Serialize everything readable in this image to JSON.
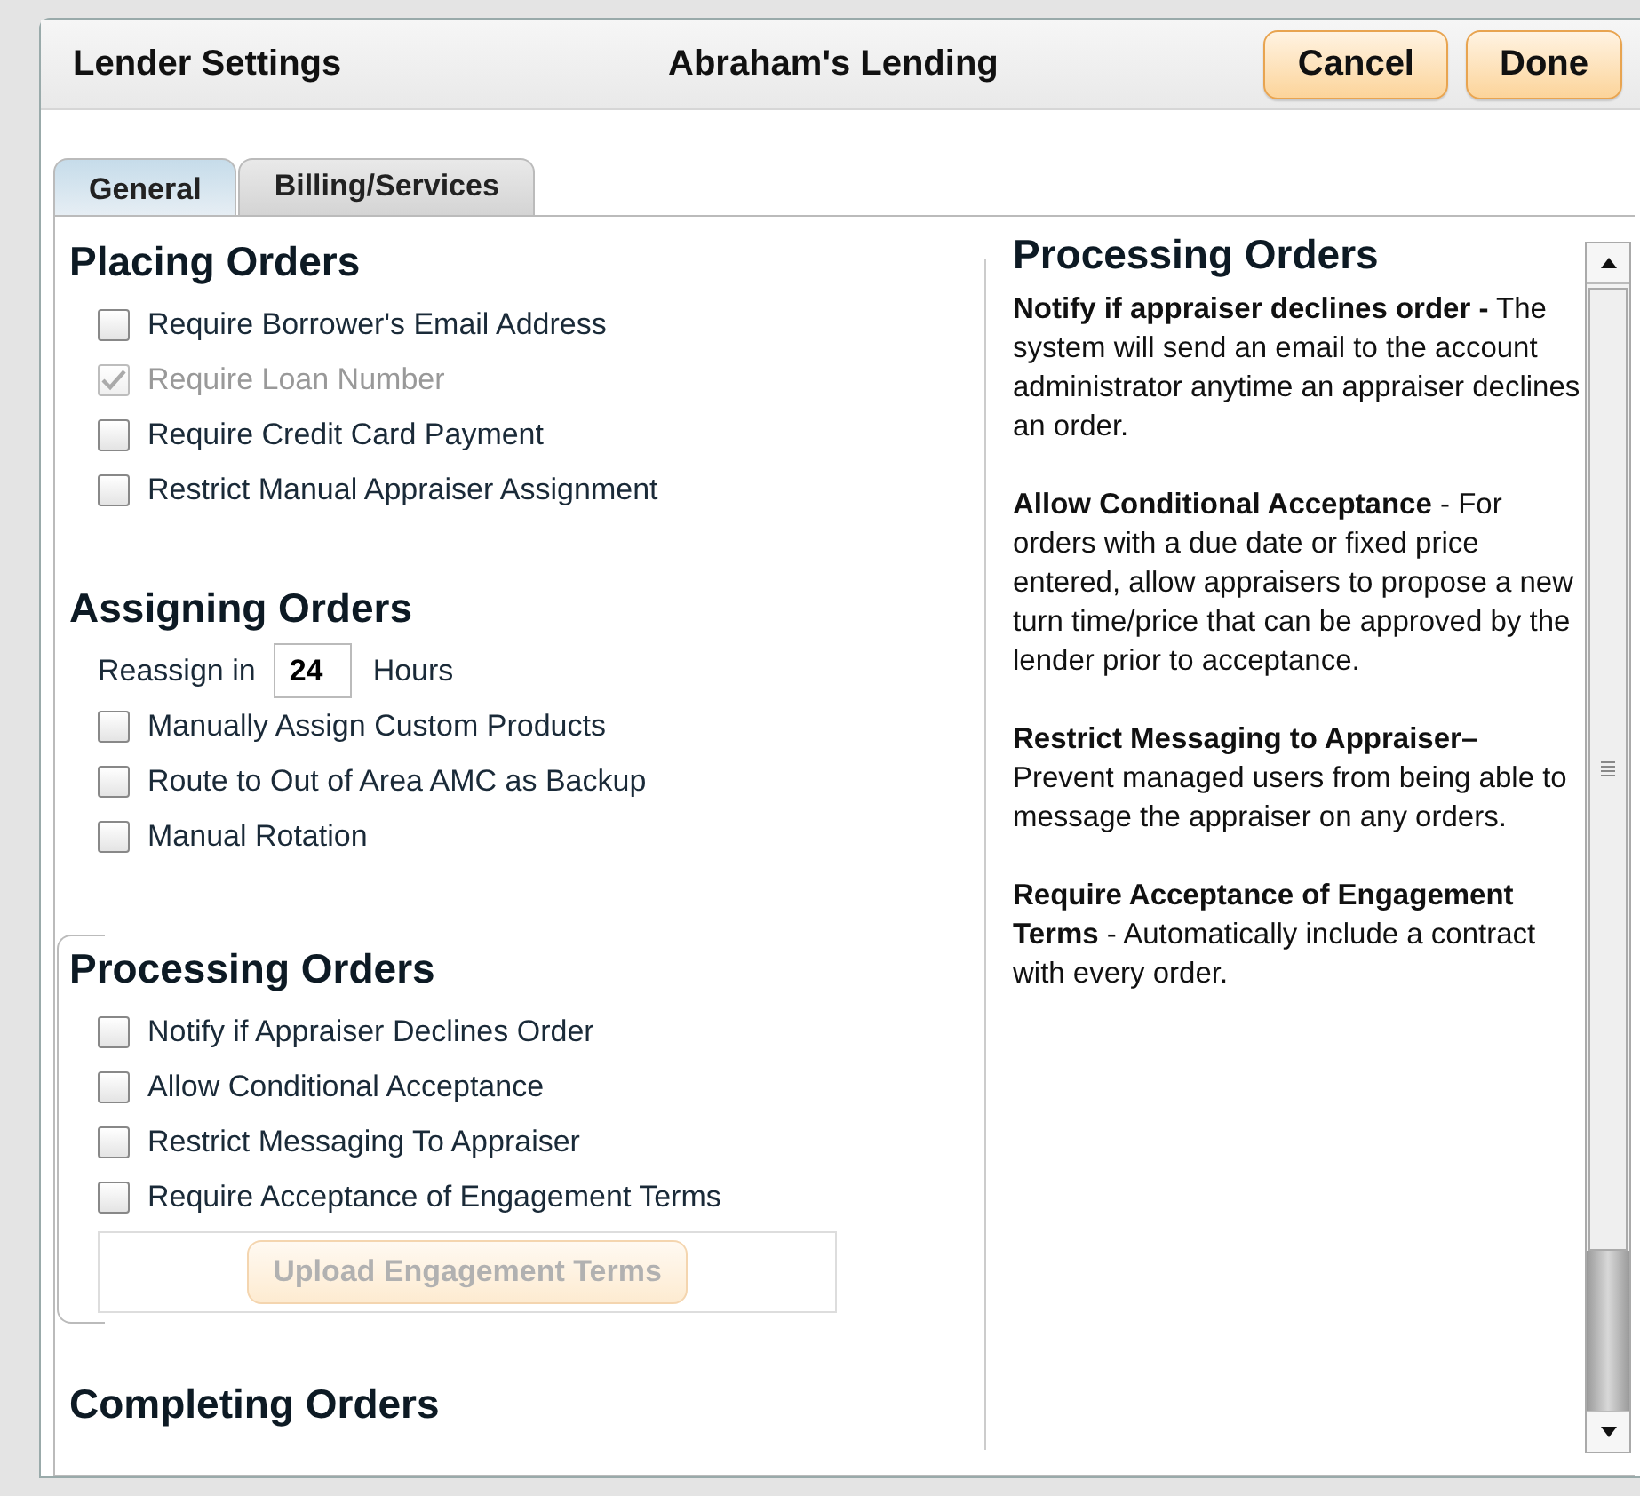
{
  "window": {
    "title": "Lender Settings",
    "subtitle": "Abraham's Lending",
    "buttons": [
      {
        "label": "Cancel"
      },
      {
        "label": "Done"
      }
    ]
  },
  "tabs": [
    {
      "label": "General",
      "selected": true
    },
    {
      "label": "Billing/Services",
      "selected": false
    }
  ],
  "sections": [
    {
      "title": "Placing Orders",
      "bracketed": false,
      "items": [
        {
          "kind": "checkbox",
          "label": "Require Borrower's Email Address",
          "checked": false,
          "disabled": false
        },
        {
          "kind": "checkbox",
          "label": "Require Loan Number",
          "checked": true,
          "disabled": true
        },
        {
          "kind": "checkbox",
          "label": "Require Credit Card Payment",
          "checked": false,
          "disabled": false
        },
        {
          "kind": "checkbox",
          "label": "Restrict Manual Appraiser Assignment",
          "checked": false,
          "disabled": false
        }
      ]
    },
    {
      "title": "Assigning Orders",
      "bracketed": false,
      "items": [
        {
          "kind": "number",
          "label": "Reassign in",
          "value": "24",
          "unit": "Hours"
        },
        {
          "kind": "checkbox",
          "label": "Manually Assign Custom Products",
          "checked": false,
          "disabled": false
        },
        {
          "kind": "checkbox",
          "label": "Route to Out of Area AMC as Backup",
          "checked": false,
          "disabled": false
        },
        {
          "kind": "checkbox",
          "label": "Manual Rotation",
          "checked": false,
          "disabled": false
        }
      ]
    },
    {
      "title": "Processing Orders",
      "bracketed": true,
      "items": [
        {
          "kind": "checkbox",
          "label": "Notify if Appraiser Declines Order",
          "checked": false,
          "disabled": false
        },
        {
          "kind": "checkbox",
          "label": "Allow Conditional Acceptance",
          "checked": false,
          "disabled": false
        },
        {
          "kind": "checkbox",
          "label": "Restrict Messaging To Appraiser",
          "checked": false,
          "disabled": false
        },
        {
          "kind": "checkbox",
          "label": "Require Acceptance of Engagement Terms",
          "checked": false,
          "disabled": false
        },
        {
          "kind": "button",
          "label": "Upload Engagement Terms",
          "disabled": true
        }
      ]
    },
    {
      "title": "Completing Orders",
      "bracketed": false
    }
  ],
  "help": {
    "title": "Processing Orders",
    "paragraphs": [
      "**Notify if appraiser declines order -** The system will send an email to the account administrator anytime an appraiser declines an order.",
      "**Allow Conditional Acceptance** - For orders with a due date or fixed price entered, allow appraisers to propose a new turn time/price that can be approved by the lender prior to acceptance.",
      "**Restrict Messaging to Appraiser–** Prevent managed users from being able to message the appraiser on any orders.",
      "**Require Acceptance of Engagement Terms** - Automatically include a contract with every order."
    ]
  }
}
